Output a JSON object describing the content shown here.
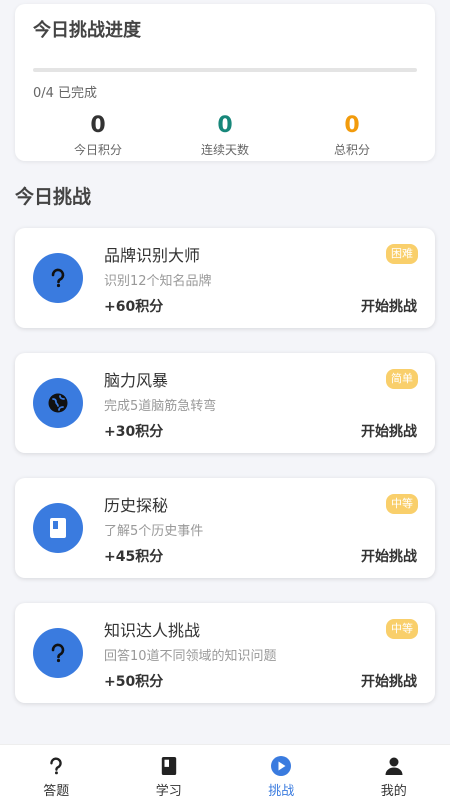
{
  "progress": {
    "title": "今日挑战进度",
    "completed_text": "0/4 已完成",
    "fraction": 0,
    "stats": [
      {
        "value": "0",
        "label": "今日积分",
        "color": "#333333"
      },
      {
        "value": "0",
        "label": "连续天数",
        "color": "#17877a"
      },
      {
        "value": "0",
        "label": "总积分",
        "color": "#f29b0c"
      }
    ]
  },
  "section_title": "今日挑战",
  "challenges": [
    {
      "name": "品牌识别大师",
      "desc": "识别12个知名品牌",
      "points": "+60积分",
      "start": "开始挑战",
      "difficulty": "困难",
      "icon": "question-icon"
    },
    {
      "name": "脑力风暴",
      "desc": "完成5道脑筋急转弯",
      "points": "+30积分",
      "start": "开始挑战",
      "difficulty": "简单",
      "icon": "globe-icon"
    },
    {
      "name": "历史探秘",
      "desc": "了解5个历史事件",
      "points": "+45积分",
      "start": "开始挑战",
      "difficulty": "中等",
      "icon": "book-icon"
    },
    {
      "name": "知识达人挑战",
      "desc": "回答10道不同领域的知识问题",
      "points": "+50积分",
      "start": "开始挑战",
      "difficulty": "中等",
      "icon": "question-icon"
    }
  ],
  "tabs": [
    {
      "label": "答题",
      "icon": "question-icon",
      "active": false
    },
    {
      "label": "学习",
      "icon": "book-icon",
      "active": false
    },
    {
      "label": "挑战",
      "icon": "play-icon",
      "active": true
    },
    {
      "label": "我的",
      "icon": "user-icon",
      "active": false
    }
  ],
  "colors": {
    "accent": "#3a7bdf",
    "badge": "#f9cf6b"
  }
}
